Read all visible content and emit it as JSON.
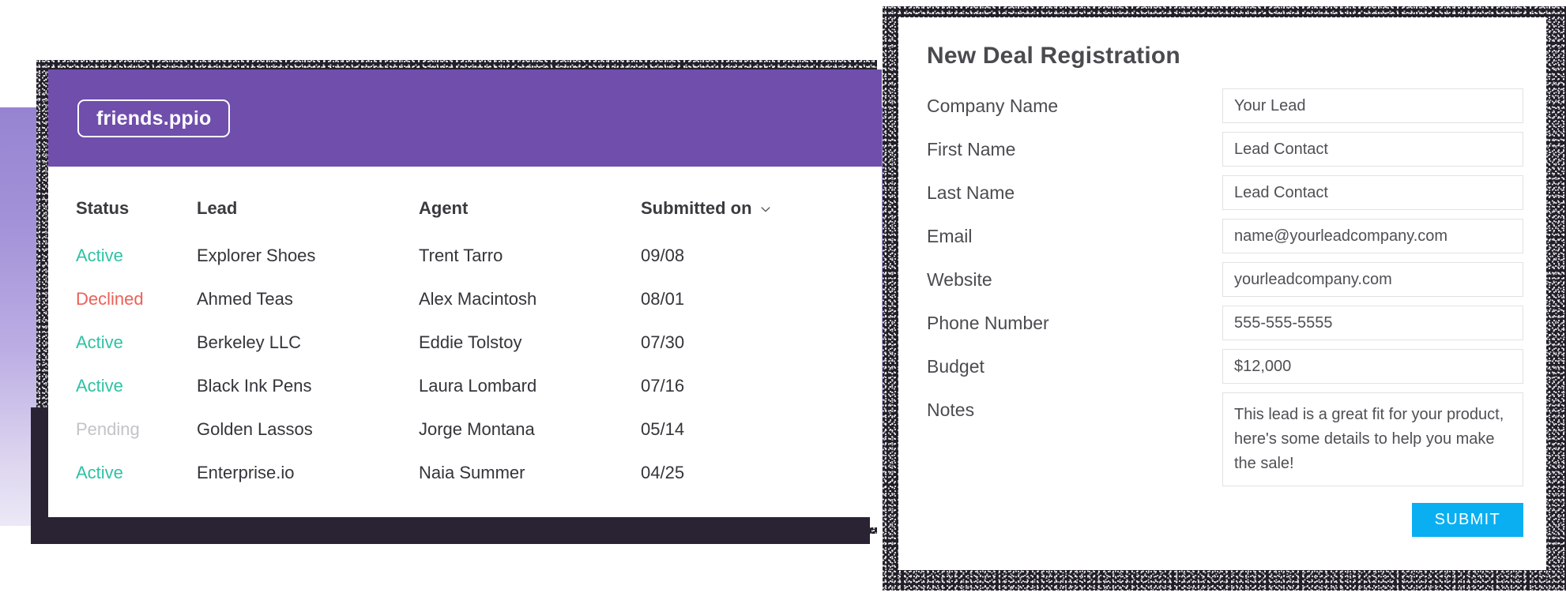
{
  "colors": {
    "header_purple": "#6f4eac",
    "band_top": "#9684d2",
    "band_bottom": "#ece8f6",
    "shadow_dark": "#2a2333",
    "status_active": "#2ec2a3",
    "status_declined": "#e9615a",
    "status_pending": "#c3c3c9",
    "submit_blue": "#0aaff1",
    "input_border": "#e2e2e6"
  },
  "portal": {
    "brand_label": "friends.ppio",
    "table": {
      "columns": [
        "Status",
        "Lead",
        "Agent",
        "Submitted on"
      ],
      "sort_column": "Submitted on",
      "sort_icon": "chevron-down-icon",
      "rows": [
        {
          "status": "Active",
          "lead": "Explorer Shoes",
          "agent": "Trent Tarro",
          "submitted_on": "09/08"
        },
        {
          "status": "Declined",
          "lead": "Ahmed Teas",
          "agent": "Alex Macintosh",
          "submitted_on": "08/01"
        },
        {
          "status": "Active",
          "lead": "Berkeley LLC",
          "agent": "Eddie Tolstoy",
          "submitted_on": "07/30"
        },
        {
          "status": "Active",
          "lead": "Black Ink Pens",
          "agent": "Laura Lombard",
          "submitted_on": "07/16"
        },
        {
          "status": "Pending",
          "lead": "Golden Lassos",
          "agent": "Jorge Montana",
          "submitted_on": "05/14"
        },
        {
          "status": "Active",
          "lead": "Enterprise.io",
          "agent": "Naia Summer",
          "submitted_on": "04/25"
        }
      ]
    }
  },
  "modal": {
    "title": "New Deal Registration",
    "fields": [
      {
        "label": "Company Name",
        "value": "Your Lead",
        "type": "text"
      },
      {
        "label": "First Name",
        "value": "Lead Contact",
        "type": "text"
      },
      {
        "label": "Last Name",
        "value": "Lead Contact",
        "type": "text"
      },
      {
        "label": "Email",
        "value": "name@yourleadcompany.com",
        "type": "text"
      },
      {
        "label": "Website",
        "value": "yourleadcompany.com",
        "type": "text"
      },
      {
        "label": "Phone Number",
        "value": "555-555-5555",
        "type": "text"
      },
      {
        "label": "Budget",
        "value": "$12,000",
        "type": "text"
      },
      {
        "label": "Notes",
        "value": "This lead is a great fit for your product, here's some details to help you make the sale!",
        "type": "textarea"
      }
    ],
    "submit_label": "SUBMIT"
  }
}
